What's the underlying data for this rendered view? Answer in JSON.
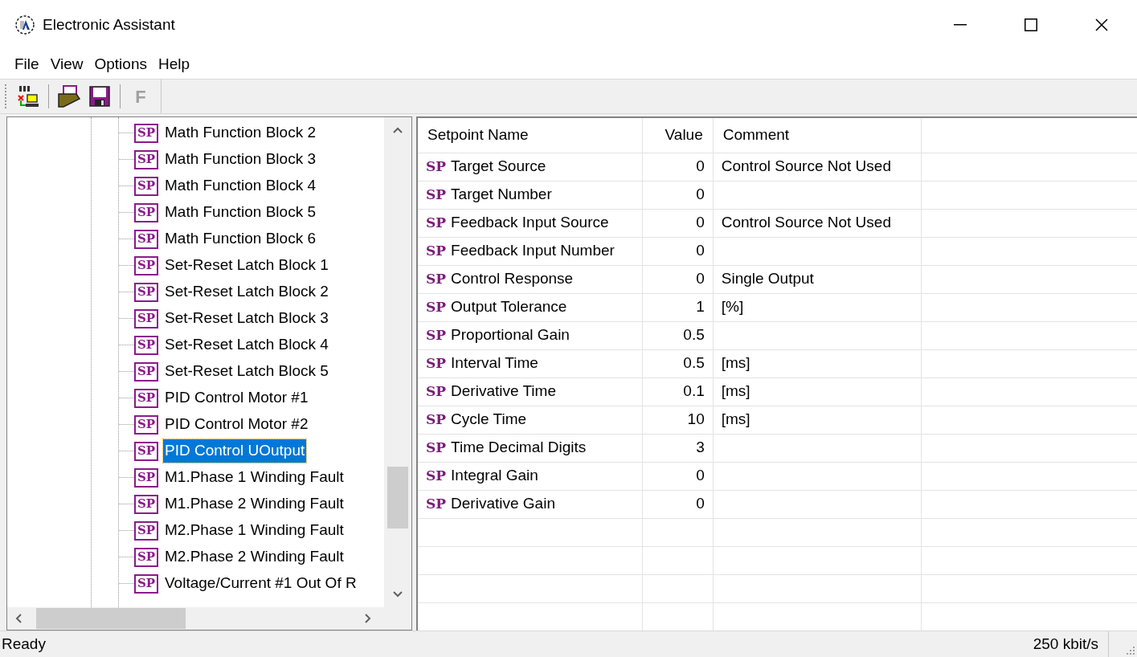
{
  "window": {
    "title": "Electronic Assistant"
  },
  "menu": [
    {
      "label": "File"
    },
    {
      "label": "View"
    },
    {
      "label": "Options"
    },
    {
      "label": "Help"
    }
  ],
  "toolbar": [
    {
      "kind": "can"
    },
    {
      "kind": "open"
    },
    {
      "kind": "save"
    },
    {
      "kind": "text",
      "label": "F",
      "disabled": true
    }
  ],
  "tree": {
    "items": [
      {
        "marker": "SP",
        "label": "Math Function Block 2",
        "selected": false
      },
      {
        "marker": "SP",
        "label": "Math Function Block 3",
        "selected": false
      },
      {
        "marker": "SP",
        "label": "Math Function Block 4",
        "selected": false
      },
      {
        "marker": "SP",
        "label": "Math Function Block 5",
        "selected": false
      },
      {
        "marker": "SP",
        "label": "Math Function Block 6",
        "selected": false
      },
      {
        "marker": "SP",
        "label": "Set-Reset Latch Block 1",
        "selected": false
      },
      {
        "marker": "SP",
        "label": "Set-Reset Latch Block 2",
        "selected": false
      },
      {
        "marker": "SP",
        "label": "Set-Reset Latch Block 3",
        "selected": false
      },
      {
        "marker": "SP",
        "label": "Set-Reset Latch Block 4",
        "selected": false
      },
      {
        "marker": "SP",
        "label": "Set-Reset Latch Block 5",
        "selected": false
      },
      {
        "marker": "SP",
        "label": "PID Control Motor #1",
        "selected": false
      },
      {
        "marker": "SP",
        "label": "PID Control Motor #2",
        "selected": false
      },
      {
        "marker": "SP",
        "label": "PID Control UOutput",
        "selected": true
      },
      {
        "marker": "SP",
        "label": "M1.Phase 1 Winding Fault",
        "selected": false
      },
      {
        "marker": "SP",
        "label": "M1.Phase 2 Winding Fault",
        "selected": false
      },
      {
        "marker": "SP",
        "label": "M2.Phase 1 Winding Fault",
        "selected": false
      },
      {
        "marker": "SP",
        "label": "M2.Phase 2 Winding Fault",
        "selected": false
      },
      {
        "marker": "SP",
        "label": "Voltage/Current #1 Out Of R",
        "selected": false
      }
    ]
  },
  "table": {
    "columns": [
      "Setpoint Name",
      "Value",
      "Comment"
    ],
    "rows": [
      {
        "marker": "SP",
        "name": "Target Source",
        "value": "0",
        "comment": "Control Source Not Used"
      },
      {
        "marker": "SP",
        "name": "Target Number",
        "value": "0"
      },
      {
        "marker": "SP",
        "name": "Feedback Input Source",
        "value": "0",
        "comment": "Control Source Not Used"
      },
      {
        "marker": "SP",
        "name": "Feedback Input Number",
        "value": "0"
      },
      {
        "marker": "SP",
        "name": "Control Response",
        "value": "0",
        "comment": "Single Output"
      },
      {
        "marker": "SP",
        "name": "Output Tolerance",
        "value": "1",
        "comment": "[%]"
      },
      {
        "marker": "SP",
        "name": "Proportional Gain",
        "value": "0.5"
      },
      {
        "marker": "SP",
        "name": "Interval Time",
        "value": "0.5",
        "comment": "[ms]"
      },
      {
        "marker": "SP",
        "name": "Derivative Time",
        "value": "0.1",
        "comment": "[ms]"
      },
      {
        "marker": "SP",
        "name": "Cycle Time",
        "value": "10",
        "comment": "[ms]"
      },
      {
        "marker": "SP",
        "name": "Time Decimal Digits",
        "value": "3"
      },
      {
        "marker": "SP",
        "name": "Integral Gain",
        "value": "0"
      },
      {
        "marker": "SP",
        "name": "Derivative Gain",
        "value": "0"
      }
    ]
  },
  "status_bar": {
    "message": "Ready",
    "baud_rate": "250 kbit/s"
  }
}
